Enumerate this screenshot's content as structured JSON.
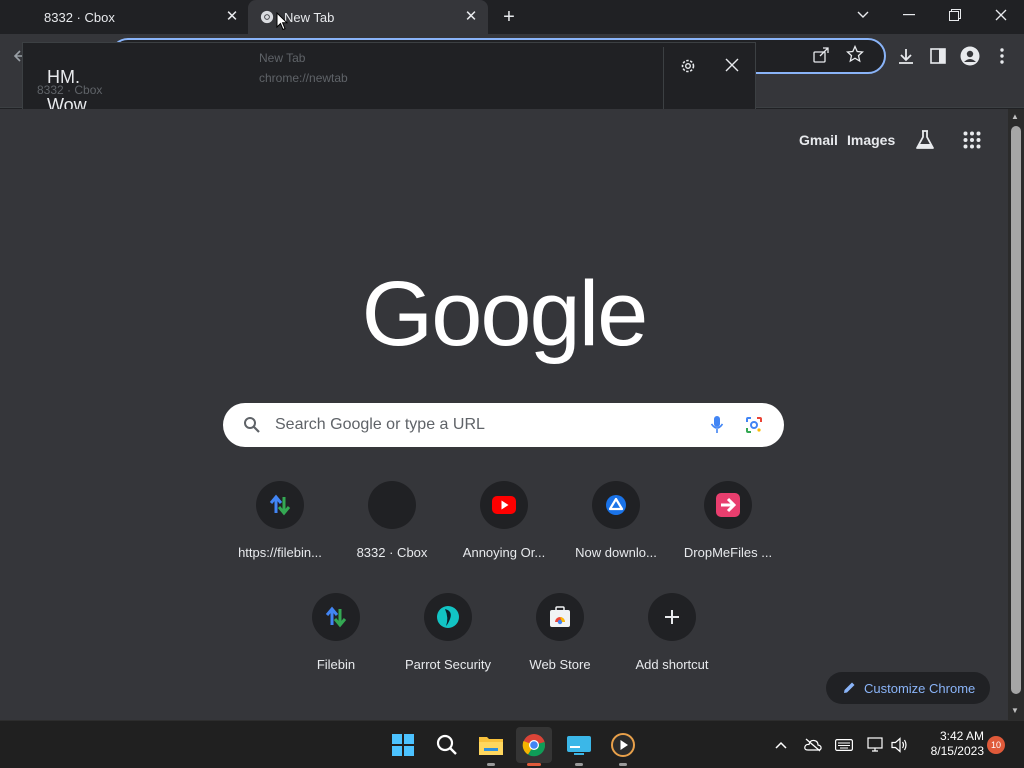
{
  "tabs": [
    {
      "label": "8332 · Cbox"
    },
    {
      "label": "New Tab"
    }
  ],
  "notification": {
    "line1": "HM.",
    "line2": "Wow",
    "ghost_title": "New Tab",
    "ghost_url": "chrome://newtab",
    "ghost_left": "8332 · Cbox"
  },
  "header_links": {
    "gmail": "Gmail",
    "images": "Images"
  },
  "logo": "Google",
  "search": {
    "placeholder": "Search Google or type a URL"
  },
  "shortcuts": [
    {
      "label": "https://filebin...",
      "icon": "filebin-arrows-icon"
    },
    {
      "label": "8332 · Cbox",
      "icon": "cbox-icon"
    },
    {
      "label": "Annoying Or...",
      "icon": "youtube-icon"
    },
    {
      "label": "Now downlo...",
      "icon": "drive-icon"
    },
    {
      "label": "DropMeFiles ...",
      "icon": "dropmefiles-icon"
    },
    {
      "label": "Filebin",
      "icon": "filebin-arrows-icon"
    },
    {
      "label": "Parrot Security",
      "icon": "parrot-icon"
    },
    {
      "label": "Web Store",
      "icon": "webstore-icon"
    },
    {
      "label": "Add shortcut",
      "icon": "plus-icon"
    }
  ],
  "customize": {
    "label": "Customize Chrome"
  },
  "taskbar": {
    "time": "3:42 AM",
    "date": "8/15/2023",
    "notif_count": "10"
  },
  "colors": {
    "accent": "#8ab4f8",
    "page_bg": "#35363a",
    "dark_bg": "#202124"
  }
}
